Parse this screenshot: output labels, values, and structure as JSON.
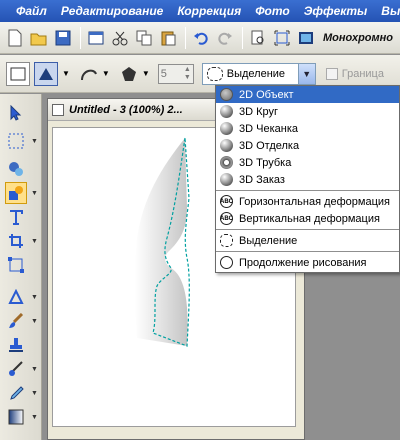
{
  "menu": [
    "Файл",
    "Редактирование",
    "Коррекция",
    "Фото",
    "Эффекты",
    "Вы"
  ],
  "toolbar": {
    "mono_label": "Монохромно",
    "icons": [
      "new-icon",
      "open-icon",
      "save-icon",
      "window-icon",
      "cut-icon",
      "copy-icon",
      "paste-icon",
      "undo-icon",
      "redo-icon",
      "print-preview-icon",
      "fit-icon",
      "color-icon"
    ]
  },
  "options": {
    "number_value": "5",
    "select_value": "Выделение",
    "border_label": "Граница"
  },
  "dropdown": {
    "items": [
      {
        "label": "2D Объект",
        "icon": "b2d",
        "selected": true
      },
      {
        "label": "3D Круг",
        "icon": "b3d"
      },
      {
        "label": "3D Чеканка",
        "icon": "b3d"
      },
      {
        "label": "3D Отделка",
        "icon": "b3d"
      },
      {
        "label": "3D Трубка",
        "icon": "ring"
      },
      {
        "label": "3D Заказ",
        "icon": "b3d"
      },
      {
        "label": "Горизонтальная деформация",
        "icon": "abc"
      },
      {
        "label": "Вертикальная деформация",
        "icon": "abc"
      },
      {
        "label": "Выделение",
        "icon": "sel"
      },
      {
        "label": "Продолжение рисования",
        "icon": "circ"
      }
    ]
  },
  "document": {
    "title": "Untitled - 3 (100%) 2..."
  },
  "colors": {
    "menubar": "#2553b4",
    "selection": "#316ac5",
    "marquee": "#00a0a0"
  }
}
